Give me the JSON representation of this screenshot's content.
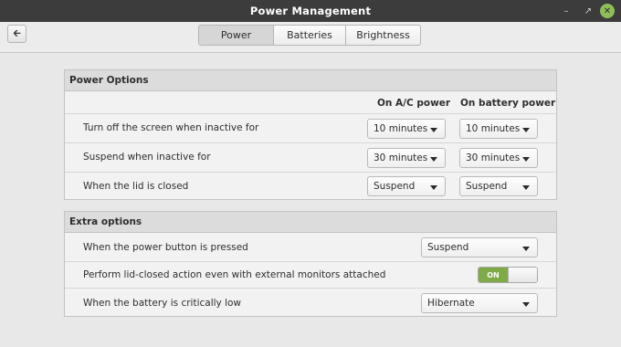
{
  "window": {
    "title": "Power Management"
  },
  "toolbar": {
    "tabs": [
      {
        "label": "Power",
        "active": true
      },
      {
        "label": "Batteries",
        "active": false
      },
      {
        "label": "Brightness",
        "active": false
      }
    ]
  },
  "power_options": {
    "title": "Power Options",
    "col_ac": "On A/C power",
    "col_battery": "On battery power",
    "rows": [
      {
        "label": "Turn off the screen when inactive for",
        "ac": "10 minutes",
        "battery": "10 minutes"
      },
      {
        "label": "Suspend when inactive for",
        "ac": "30 minutes",
        "battery": "30 minutes"
      },
      {
        "label": "When the lid is closed",
        "ac": "Suspend",
        "battery": "Suspend"
      }
    ]
  },
  "extra_options": {
    "title": "Extra options",
    "power_button_label": "When the power button is pressed",
    "power_button_value": "Suspend",
    "lid_monitors_label": "Perform lid-closed action even with external monitors attached",
    "lid_monitors_state": "ON",
    "critical_label": "When the battery is critically low",
    "critical_value": "Hibernate"
  },
  "colors": {
    "accent": "#7faa48",
    "titlebar": "#3c3c3c",
    "close": "#8fbf5a"
  }
}
